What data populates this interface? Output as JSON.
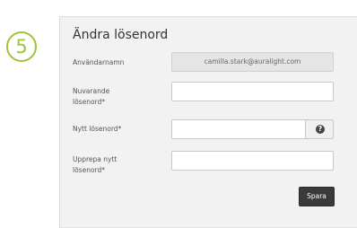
{
  "step": {
    "number": "5"
  },
  "form": {
    "title": "Ändra lösenord",
    "username": {
      "label": "Användarnamn",
      "value": "camilla.stark@auralight.com"
    },
    "current_password": {
      "label": "Nuvarande lösenord*",
      "value": ""
    },
    "new_password": {
      "label": "Nytt lösenord*",
      "value": "",
      "help_icon": "question-mark-icon"
    },
    "repeat_password": {
      "label": "Upprepa nytt lösenord*",
      "value": ""
    },
    "save_label": "Spara"
  },
  "colors": {
    "accent": "#9fc33a",
    "button": "#3a3a3a",
    "panel_bg": "#f2f2f2"
  }
}
